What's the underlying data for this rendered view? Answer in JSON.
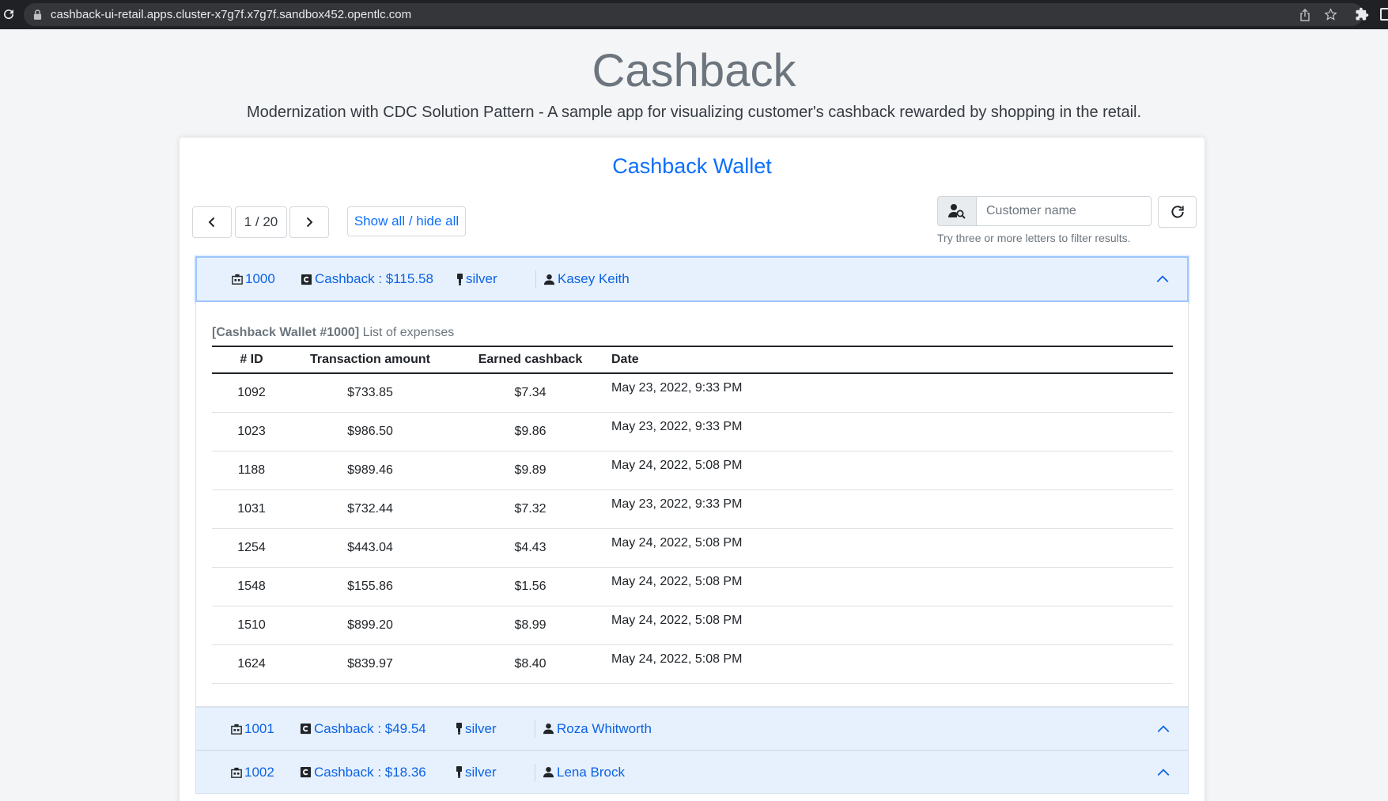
{
  "browser": {
    "url": "cashback-ui-retail.apps.cluster-x7g7f.x7g7f.sandbox452.opentlc.com"
  },
  "header": {
    "title": "Cashback",
    "subtitle": "Modernization with CDC Solution Pattern - A sample app for visualizing customer's cashback rewarded by shopping in the retail."
  },
  "card": {
    "title": "Cashback Wallet"
  },
  "pagination": {
    "current": "1 / 20",
    "show_all_label": "Show all / hide all"
  },
  "search": {
    "placeholder": "Customer name",
    "hint": "Try three or more letters to filter results."
  },
  "wallets": [
    {
      "id": "1000",
      "cashback": "Cashback : $115.58",
      "tier": "silver",
      "customer": "Kasey Keith",
      "expanded": true
    },
    {
      "id": "1001",
      "cashback": "Cashback : $49.54",
      "tier": "silver",
      "customer": "Roza Whitworth",
      "expanded": false
    },
    {
      "id": "1002",
      "cashback": "Cashback : $18.36",
      "tier": "silver",
      "customer": "Lena Brock",
      "expanded": false
    }
  ],
  "expenses": {
    "caption_bold": "[Cashback Wallet #1000]",
    "caption_rest": " List of expenses",
    "columns": [
      "# ID",
      "Transaction amount",
      "Earned cashback",
      "Date"
    ],
    "rows": [
      [
        "1092",
        "$733.85",
        "$7.34",
        "May 23, 2022, 9:33 PM"
      ],
      [
        "1023",
        "$986.50",
        "$9.86",
        "May 23, 2022, 9:33 PM"
      ],
      [
        "1188",
        "$989.46",
        "$9.89",
        "May 24, 2022, 5:08 PM"
      ],
      [
        "1031",
        "$732.44",
        "$7.32",
        "May 23, 2022, 9:33 PM"
      ],
      [
        "1254",
        "$443.04",
        "$4.43",
        "May 24, 2022, 5:08 PM"
      ],
      [
        "1548",
        "$155.86",
        "$1.56",
        "May 24, 2022, 5:08 PM"
      ],
      [
        "1510",
        "$899.20",
        "$8.99",
        "May 24, 2022, 5:08 PM"
      ],
      [
        "1624",
        "$839.97",
        "$8.40",
        "May 24, 2022, 5:08 PM"
      ]
    ]
  },
  "colors": {
    "accent": "#0d6efd",
    "accordion_bg": "#e7f1fd",
    "chrome_bg": "#202124"
  }
}
